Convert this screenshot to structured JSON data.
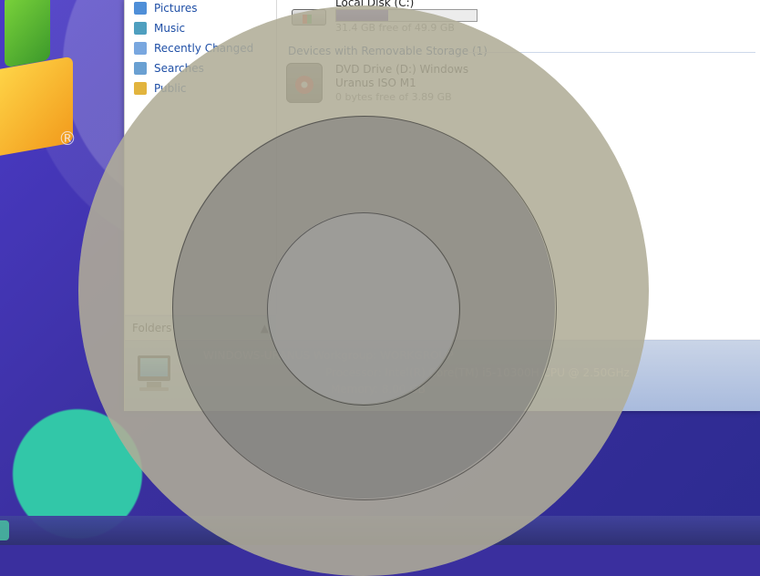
{
  "desktop": {
    "registered_mark": "®"
  },
  "nav": {
    "items": [
      {
        "label": "Pictures",
        "icon": "pictures-icon",
        "color": "#4f8fd8"
      },
      {
        "label": "Music",
        "icon": "music-icon",
        "color": "#4f9fbf"
      },
      {
        "label": "Recently Changed",
        "icon": "recent-icon",
        "color": "#79a7df"
      },
      {
        "label": "Searches",
        "icon": "search-icon",
        "color": "#6aa0d2"
      },
      {
        "label": "Public",
        "icon": "folder-icon",
        "color": "#e2b43e"
      }
    ],
    "folders_label": "Folders"
  },
  "content": {
    "local_disk": {
      "name": "Local Disk (C:)",
      "free_text": "31.4 GB free of 49.9 GB",
      "used_fraction": 0.37
    },
    "removable_header": "Devices with Removable Storage (1)",
    "dvd_drive": {
      "name": "DVD Drive (D:) Windows Uranus ISO M1",
      "free_text": "0 bytes free of 3.89 GB"
    }
  },
  "details": {
    "computer_line": "WINDOWS-URANUS  Workgroup: WORKGROUP",
    "processor_line": "Processor: Intel(R) Core(TM) i5-10300H CPU @ 2.50GHz",
    "memory_line": "Memory: 8.00 GB"
  }
}
